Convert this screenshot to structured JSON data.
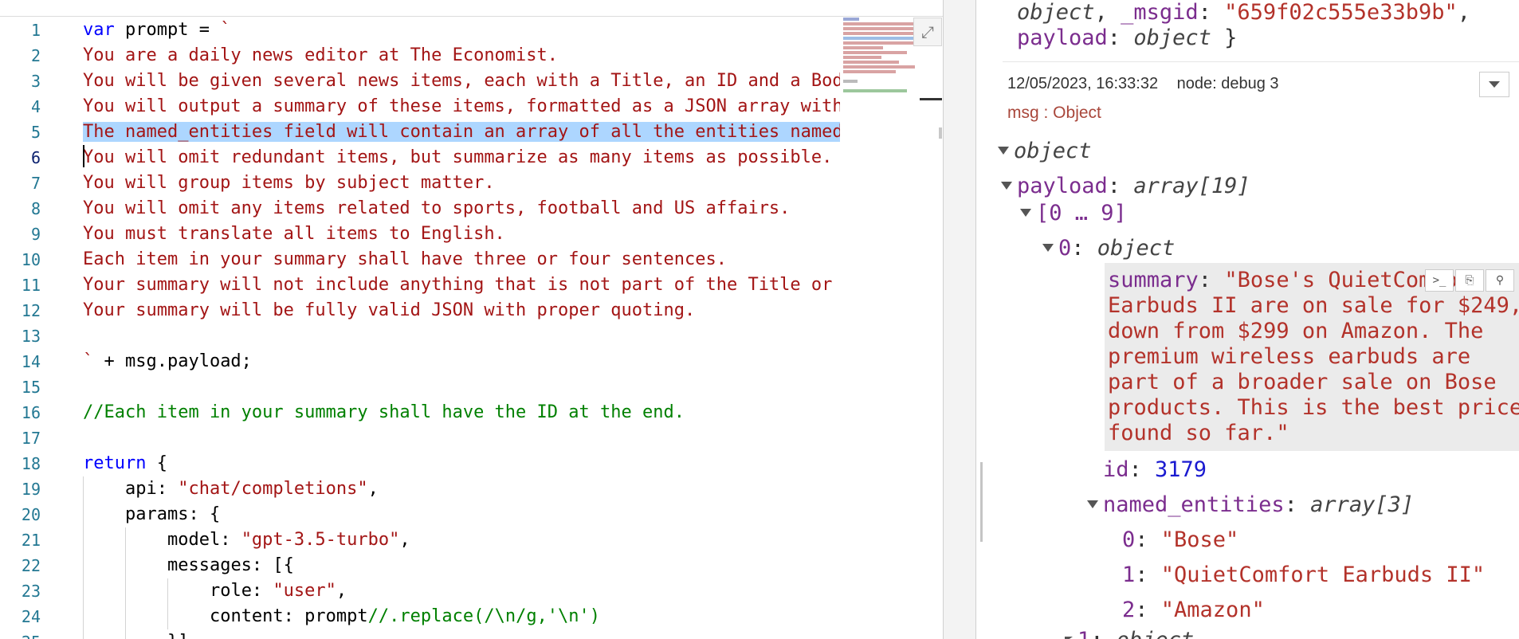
{
  "editor": {
    "line_numbers": [
      "1",
      "2",
      "3",
      "4",
      "5",
      "6",
      "7",
      "8",
      "9",
      "10",
      "11",
      "12",
      "13",
      "14",
      "15",
      "16",
      "17",
      "18",
      "19",
      "20",
      "21",
      "22",
      "23",
      "24",
      "25"
    ],
    "lines": [
      "You are a daily news editor at The Economist.",
      "You will be given several news items, each with a Title, an ID and a Body.",
      "You will output a summary of these items, formatted as a JSON array with",
      "The named_entities field will contain an array of all the entities named",
      "You will omit redundant items, but summarize as many items as possible.",
      "You will group items by subject matter.",
      "You will omit any items related to sports, football and US affairs.",
      "You must translate all items to English.",
      "Each item in your summary shall have three or four sentences.",
      "Your summary will not include anything that is not part of the Title or",
      "Your summary will be fully valid JSON with proper quoting."
    ],
    "tokens": {
      "var": "var",
      "prompt_decl": " prompt = ",
      "backtick": "`",
      "plus_payload": " + msg.payload;",
      "comment_line": "//Each item in your summary shall have the ID at the end.",
      "return_kw": "return",
      "return_brace": " {",
      "api_key": "api: ",
      "api_val": "\"chat/completions\"",
      "comma": ",",
      "params": "params: {",
      "model_key": "model: ",
      "model_val": "\"gpt-3.5-turbo\"",
      "messages": "messages: [{",
      "role_key": "role: ",
      "role_val": "\"user\"",
      "content_key": "content: prompt",
      "content_cmt": "//.replace(/\\n/g,'\\n')",
      "close": "}]"
    },
    "expand_icon": "expand-icon"
  },
  "debug": {
    "top_line1_key": "object",
    "top_line1_sep": ", ",
    "top_line1_msgid_key": "_msgid",
    "top_line1_colon": ": ",
    "top_line1_msgid_val": "\"659f02c555e33b9b\"",
    "top_line1_end": ",",
    "top_line2_key": "payload",
    "top_line2_colon": ": ",
    "top_line2_type": "object",
    "top_line2_end": " }",
    "timestamp": "12/05/2023, 16:33:32",
    "node": "node: debug 3",
    "msg_type": "msg : Object",
    "tree": {
      "root": "object",
      "payload_key": "payload",
      "payload_type": "array[19]",
      "range": "[0 … 9]",
      "item0_key": "0",
      "item0_type": "object",
      "summary_key": "summary",
      "summary_lines": [
        "\"Bose's QuietComfort",
        "Earbuds II are on sale for $249,",
        "down from $299 on Amazon. The",
        "premium wireless earbuds are",
        "part of a broader sale on Bose",
        "products. This is the best price",
        "found so far.\""
      ],
      "id_key": "id",
      "id_val": "3179",
      "ne_key": "named_entities",
      "ne_type": "array[3]",
      "entities": [
        {
          "idx": "0",
          "val": "\"Bose\""
        },
        {
          "idx": "1",
          "val": "\"QuietComfort Earbuds II\""
        },
        {
          "idx": "2",
          "val": "\"Amazon\""
        }
      ],
      "next_idx": "1",
      "next_type": "object"
    },
    "colors": {
      "key": "#7b2d8e",
      "string": "#b3322a",
      "number": "#1a1ad0"
    }
  }
}
